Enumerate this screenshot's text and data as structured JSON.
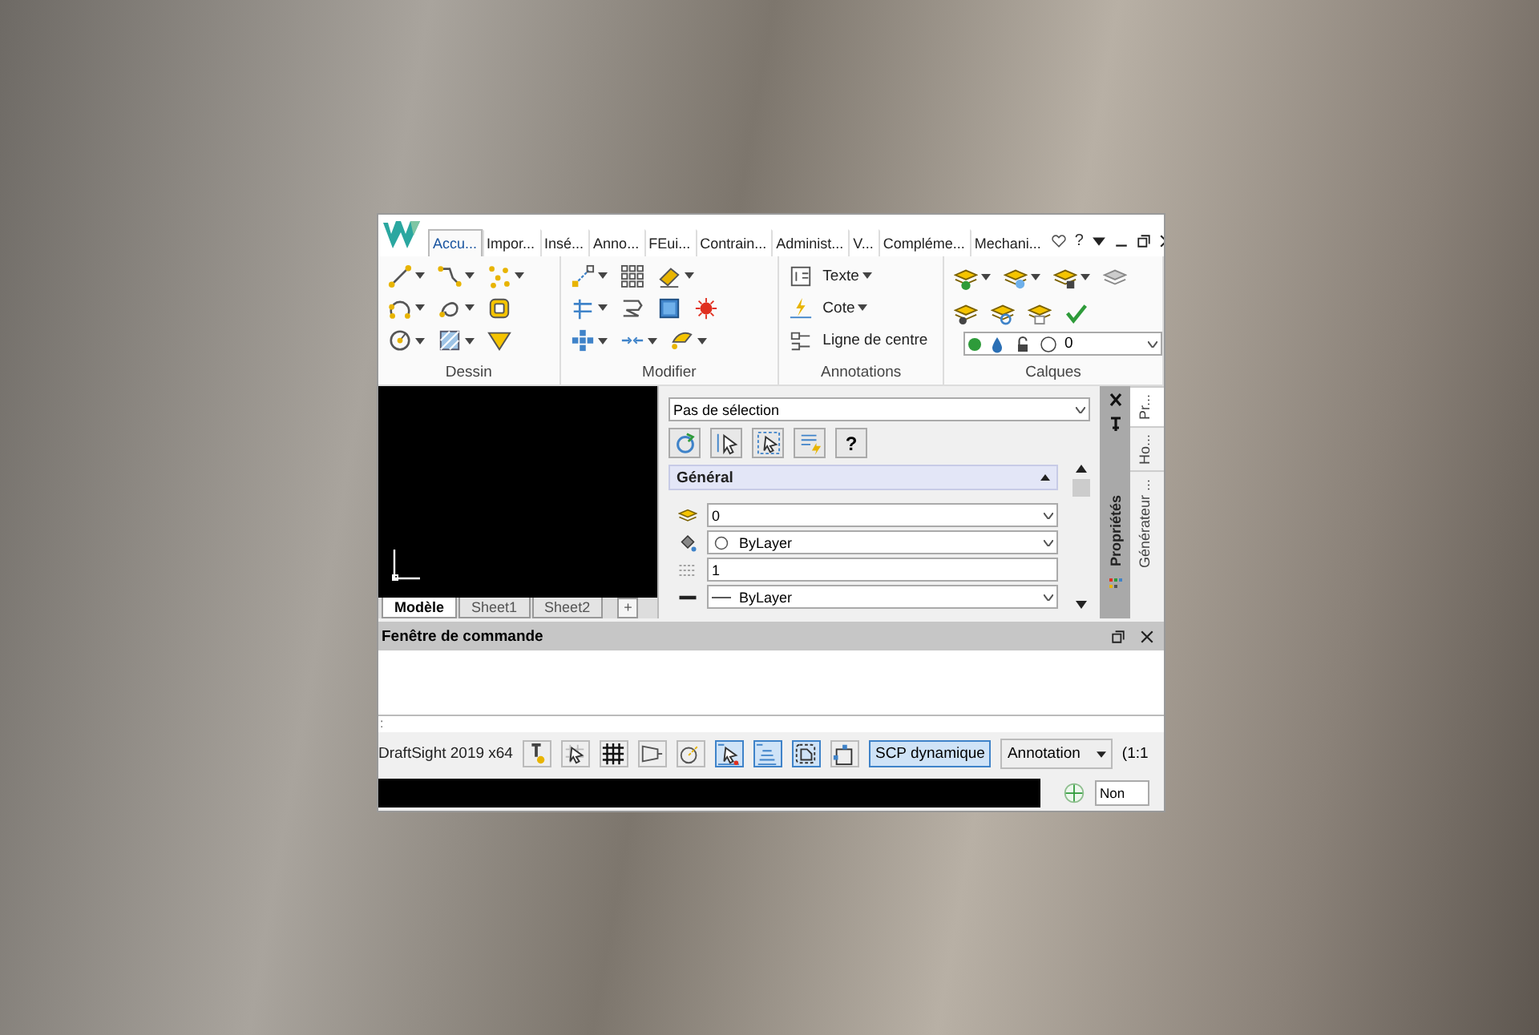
{
  "app_window": {
    "tabs": [
      {
        "label": "Accu...",
        "selected": true
      },
      {
        "label": "Impor...",
        "selected": false
      },
      {
        "label": "Insé...",
        "selected": false
      },
      {
        "label": "Anno...",
        "selected": false
      },
      {
        "label": "FEui...",
        "selected": false
      },
      {
        "label": "Contrain...",
        "selected": false
      },
      {
        "label": "Administ...",
        "selected": false
      },
      {
        "label": "V...",
        "selected": false
      },
      {
        "label": "Compléme...",
        "selected": false
      },
      {
        "label": "Mechani...",
        "selected": false
      }
    ],
    "help_label": "?",
    "ribbon": [
      {
        "title": "Dessin",
        "kind": "icons",
        "rows": [
          [
            {
              "dropdown": true
            },
            {
              "dropdown": true
            },
            {
              "dropdown": true
            }
          ],
          [
            {
              "dropdown": true
            },
            {
              "dropdown": true
            },
            {
              "dropdown": false
            }
          ],
          [
            {
              "dropdown": true
            },
            {
              "dropdown": true
            },
            {
              "dropdown": false
            }
          ]
        ]
      },
      {
        "title": "Modifier",
        "kind": "icons",
        "rows": [
          [
            {
              "dropdown": true
            },
            {
              "dropdown": false
            },
            {
              "dropdown": true
            }
          ],
          [
            {
              "dropdown": true
            },
            {
              "dropdown": false
            },
            {
              "dropdown": false
            },
            {
              "dropdown": false
            }
          ],
          [
            {
              "dropdown": true
            },
            {
              "dropdown": true
            },
            {
              "dropdown": true
            }
          ]
        ]
      },
      {
        "title": "Annotations",
        "kind": "labels",
        "rows": [
          [
            {
              "label": "Texte",
              "dropdown": true
            }
          ],
          [
            {
              "label": "Cote",
              "dropdown": true
            }
          ],
          [
            {
              "label": "Ligne de centre",
              "dropdown": false
            }
          ]
        ]
      },
      {
        "title": "Calques",
        "kind": "icons",
        "rows": [
          [
            {
              "dropdown": true
            },
            {
              "dropdown": true
            },
            {
              "dropdown": true
            },
            {
              "dropdown": false
            }
          ],
          [
            {
              "dropdown": false
            },
            {
              "dropdown": false
            },
            {
              "dropdown": false
            },
            {
              "dropdown": false
            }
          ]
        ],
        "layer_combo": {
          "value": "0",
          "color": "#2e9b3a"
        }
      }
    ],
    "sheet_tabs": [
      {
        "label": "Modèle",
        "selected": true
      },
      {
        "label": "Sheet1",
        "selected": false
      },
      {
        "label": "Sheet2",
        "selected": false
      }
    ],
    "add_sheet_label": "+",
    "properties": {
      "selection": "Pas de sélection",
      "help_label": "?",
      "section": {
        "title": "Général",
        "expanded": true
      },
      "rows": [
        {
          "kind": "layer",
          "value": "0",
          "dropdown": true
        },
        {
          "kind": "color",
          "value": "ByLayer",
          "dropdown": true
        },
        {
          "kind": "scale",
          "value": "1",
          "dropdown": false
        },
        {
          "kind": "linestyle",
          "value": "ByLayer",
          "dropdown": true
        }
      ],
      "side_title": "Propriétés",
      "side_tabs": [
        {
          "label": "Pr...",
          "selected": true
        },
        {
          "label": "Ho...",
          "selected": false
        },
        {
          "label": "Générateur ...",
          "selected": false
        }
      ]
    },
    "command_window": {
      "title": "Fenêtre de commande",
      "prompt": ":"
    },
    "status_bar": {
      "app_name": "DraftSight 2019 x64",
      "toggles": [
        {
          "selected": false
        },
        {
          "selected": false
        },
        {
          "selected": false
        },
        {
          "selected": false
        },
        {
          "selected": false
        },
        {
          "selected": true
        },
        {
          "selected": true
        },
        {
          "selected": true
        },
        {
          "selected": false
        }
      ],
      "dynamic_ucs": {
        "label": "SCP dynamique",
        "selected": true
      },
      "annotation": "Annotation",
      "scale": "(1:1"
    },
    "coordinate_field": "Non"
  }
}
